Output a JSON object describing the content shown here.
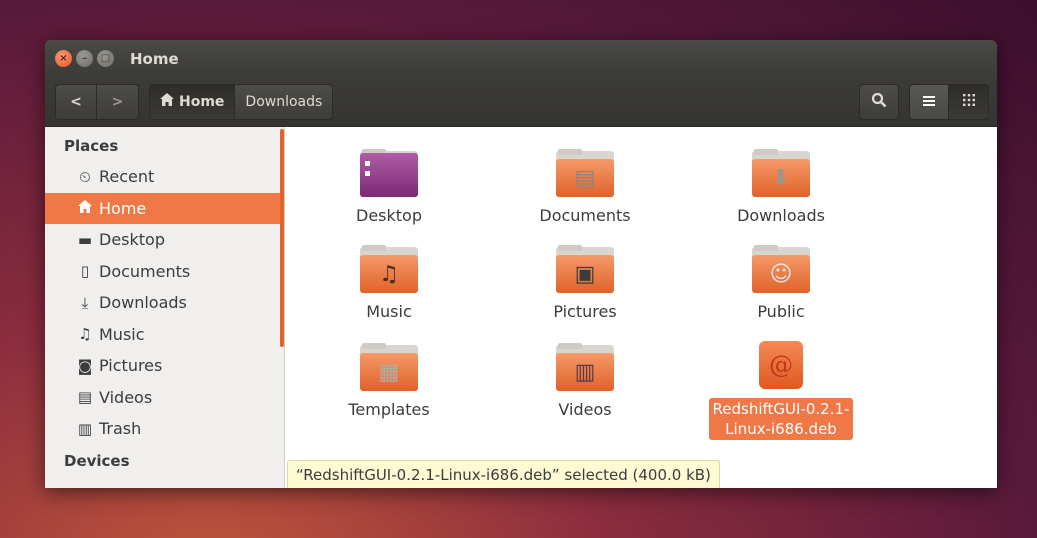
{
  "window": {
    "title": "Home"
  },
  "window_buttons": {
    "close": "×",
    "minimize": "–",
    "maximize": "□"
  },
  "toolbar": {
    "back_glyph": "<",
    "forward_glyph": ">",
    "breadcrumbs": [
      "Home",
      "Downloads"
    ],
    "search_icon": "search-icon",
    "list_view_icon": "list-icon",
    "grid_view_icon": "grid-icon"
  },
  "sidebar": {
    "places_header": "Places",
    "items": [
      {
        "label": "Recent",
        "icon": "clock-icon",
        "glyph": "⏲"
      },
      {
        "label": "Home",
        "icon": "home-icon",
        "glyph": "⌂"
      },
      {
        "label": "Desktop",
        "icon": "desktop-folder-icon",
        "glyph": "▬"
      },
      {
        "label": "Documents",
        "icon": "document-icon",
        "glyph": "▯"
      },
      {
        "label": "Downloads",
        "icon": "download-icon",
        "glyph": "⤓"
      },
      {
        "label": "Music",
        "icon": "music-icon",
        "glyph": "♫"
      },
      {
        "label": "Pictures",
        "icon": "camera-icon",
        "glyph": "◙"
      },
      {
        "label": "Videos",
        "icon": "film-icon",
        "glyph": "▤"
      },
      {
        "label": "Trash",
        "icon": "trash-icon",
        "glyph": "▥"
      }
    ],
    "active_index": 1,
    "devices_header": "Devices"
  },
  "files": [
    {
      "label": "Desktop",
      "icon": "desktop-folder-icon",
      "emblem": ""
    },
    {
      "label": "Documents",
      "icon": "documents-folder-icon",
      "emblem": "▤"
    },
    {
      "label": "Downloads",
      "icon": "downloads-folder-icon",
      "emblem": "⬇"
    },
    {
      "label": "Music",
      "icon": "music-folder-icon",
      "emblem": "♫"
    },
    {
      "label": "Pictures",
      "icon": "pictures-folder-icon",
      "emblem": "▣"
    },
    {
      "label": "Public",
      "icon": "public-folder-icon",
      "emblem": "☺"
    },
    {
      "label": "Templates",
      "icon": "templates-folder-icon",
      "emblem": "▦"
    },
    {
      "label": "Videos",
      "icon": "videos-folder-icon",
      "emblem": "▥"
    },
    {
      "label": "RedshiftGUI-0.2.1-Linux-i686.deb",
      "label_line1": "RedshiftGUI-0.2.1-",
      "label_line2": "Linux-i686.deb",
      "icon": "debian-package-icon",
      "emblem": "@",
      "selected": true
    }
  ],
  "status": {
    "text": "“RedshiftGUI-0.2.1-Linux-i686.deb” selected  (400.0 kB)"
  },
  "colors": {
    "accent": "#f07746",
    "titlebar": "#3c3b37",
    "status_bg": "#fefbd4"
  }
}
